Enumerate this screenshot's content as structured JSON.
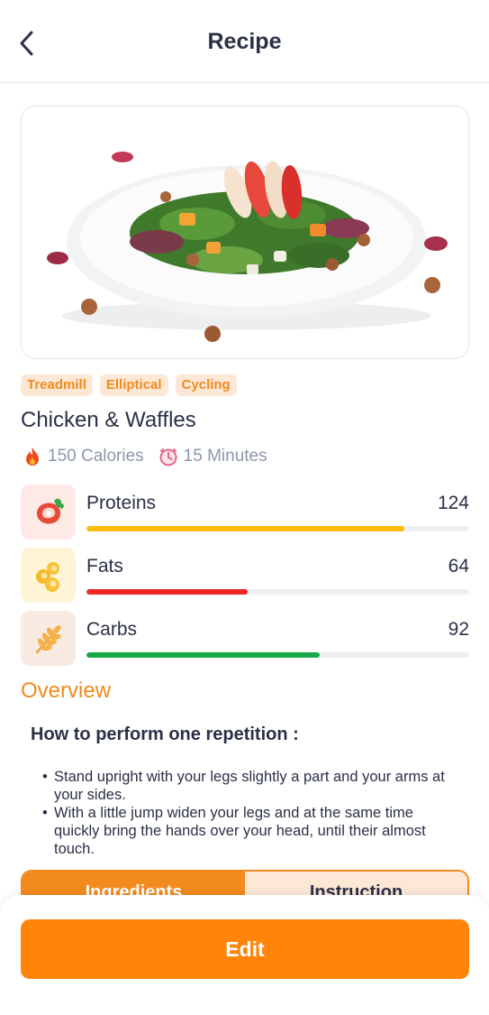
{
  "header": {
    "title": "Recipe",
    "back_icon": "chevron-left-icon"
  },
  "hero": {
    "image": "salad-plate-photo"
  },
  "tags": [
    "Treadmill",
    "Elliptical",
    "Cycling"
  ],
  "recipe": {
    "title": "Chicken & Waffles"
  },
  "meta": {
    "calories": "150 Calories",
    "calories_icon": "fire-icon",
    "duration": "15 Minutes",
    "duration_icon": "clock-icon"
  },
  "macros": [
    {
      "name": "Proteins",
      "value": "124",
      "progress": 0.83,
      "color": "#fbbd08",
      "icon": "meat-icon",
      "icon_bg": "#fde9e6"
    },
    {
      "name": "Fats",
      "value": "64",
      "progress": 0.42,
      "color": "#ee2626",
      "icon": "fat-drops-icon",
      "icon_bg": "#fff4d6"
    },
    {
      "name": "Carbs",
      "value": "92",
      "progress": 0.61,
      "color": "#18a846",
      "icon": "wheat-icon",
      "icon_bg": "#f7ebe3"
    }
  ],
  "overview": {
    "title": "Overview",
    "howto_title": "How to perform one repetition :",
    "steps": [
      "Stand upright with your legs slightly a part and your arms at your sides.",
      "With a little jump widen your legs and at the same time quickly bring the hands over your head, until their almost touch."
    ]
  },
  "tabs": [
    {
      "label": "Ingredients",
      "active": true
    },
    {
      "label": "Instruction",
      "active": false
    }
  ],
  "footer": {
    "edit_label": "Edit"
  },
  "colors": {
    "accent": "#ff8409",
    "text": "#2b3046",
    "muted": "#8e98aa",
    "tag_bg": "#fde8d6"
  }
}
